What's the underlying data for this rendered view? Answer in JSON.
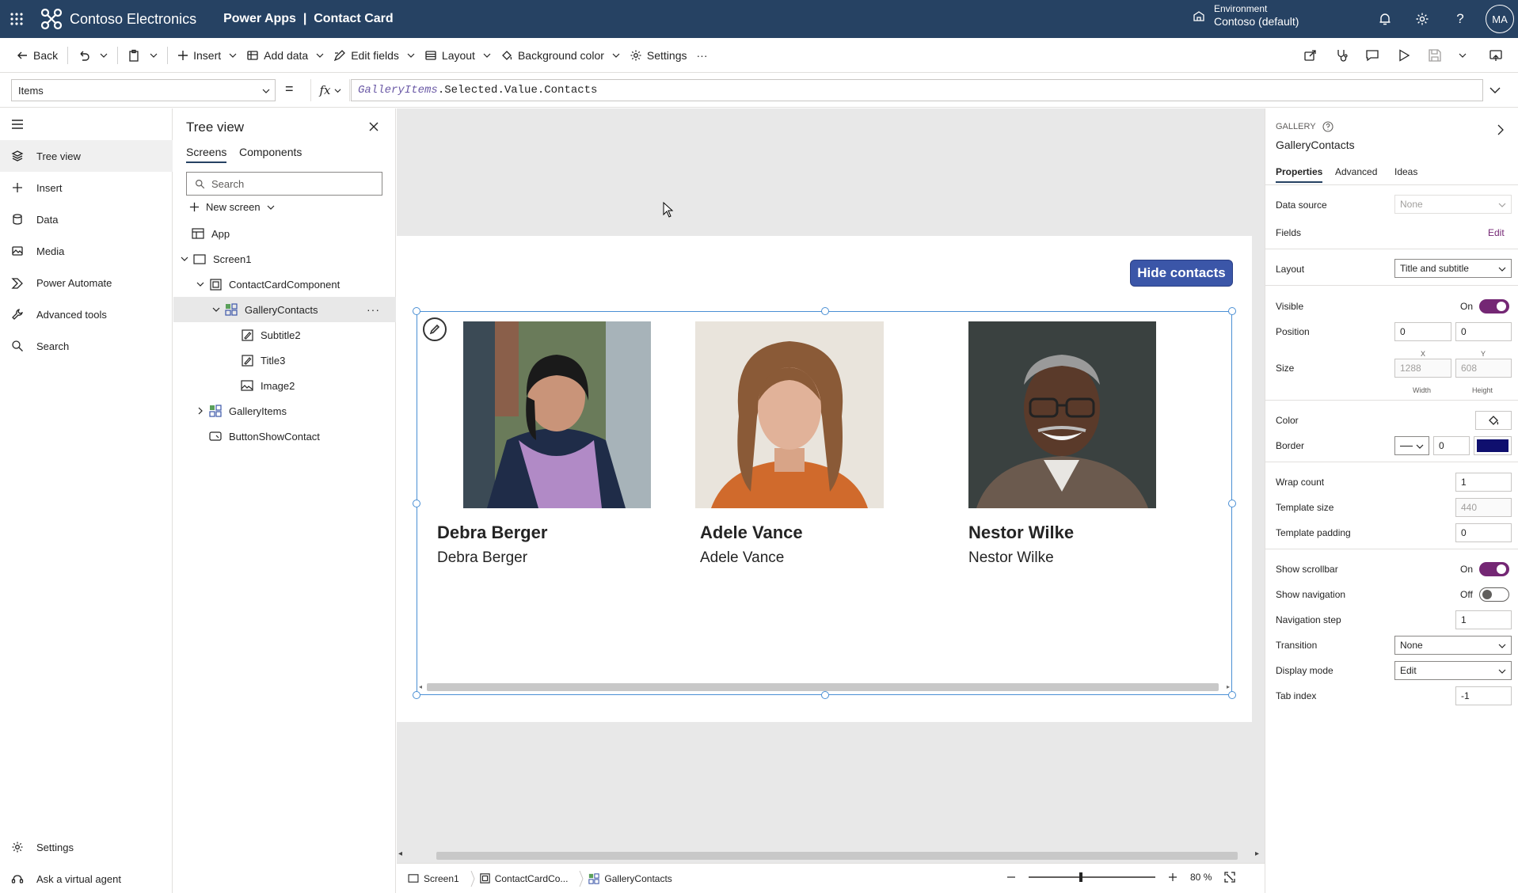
{
  "header": {
    "org_name": "Contoso Electronics",
    "app_title": "Power Apps  |  Contact Card",
    "environment_label": "Environment",
    "environment_value": "Contoso (default)",
    "avatar_initials": "MA"
  },
  "commandbar": {
    "back": "Back",
    "insert": "Insert",
    "add_data": "Add data",
    "edit_fields": "Edit fields",
    "layout": "Layout",
    "background_color": "Background color",
    "settings": "Settings",
    "more": "···"
  },
  "formulabar": {
    "property": "Items",
    "equals": "=",
    "fx": "fx",
    "formula_ident": "GalleryItems",
    "formula_rest": ".Selected.Value.Contacts"
  },
  "leftnav": {
    "items": [
      {
        "label": "Tree view",
        "icon": "layers-icon"
      },
      {
        "label": "Insert",
        "icon": "plus-icon"
      },
      {
        "label": "Data",
        "icon": "database-icon"
      },
      {
        "label": "Media",
        "icon": "media-icon"
      },
      {
        "label": "Power Automate",
        "icon": "flow-icon"
      },
      {
        "label": "Advanced tools",
        "icon": "wrench-icon"
      },
      {
        "label": "Search",
        "icon": "search-icon"
      }
    ],
    "settings": "Settings",
    "virtual_agent": "Ask a virtual agent"
  },
  "treeview": {
    "title": "Tree view",
    "tabs": [
      "Screens",
      "Components"
    ],
    "search_placeholder": "Search",
    "new_screen": "New screen",
    "nodes": [
      "App",
      "Screen1",
      "ContactCardComponent",
      "GalleryContacts",
      "Subtitle2",
      "Title3",
      "Image2",
      "GalleryItems",
      "ButtonShowContact"
    ]
  },
  "canvas": {
    "hide_button": "Hide contacts",
    "contacts": [
      {
        "title": "Debra Berger",
        "subtitle": "Debra Berger"
      },
      {
        "title": "Adele Vance",
        "subtitle": "Adele Vance"
      },
      {
        "title": "Nestor Wilke",
        "subtitle": "Nestor Wilke"
      }
    ]
  },
  "statusbar": {
    "crumbs": [
      "Screen1",
      "ContactCardCo...",
      "GalleryContacts"
    ],
    "zoom_value": "80",
    "zoom_unit": "%"
  },
  "properties": {
    "type": "GALLERY",
    "name": "GalleryContacts",
    "tabs": [
      "Properties",
      "Advanced",
      "Ideas"
    ],
    "data_source_label": "Data source",
    "data_source_value": "None",
    "fields_label": "Fields",
    "fields_edit": "Edit",
    "layout_label": "Layout",
    "layout_value": "Title and subtitle",
    "visible_label": "Visible",
    "visible_state": "On",
    "position_label": "Position",
    "position_x": "0",
    "position_y": "0",
    "x_label": "X",
    "y_label": "Y",
    "size_label": "Size",
    "size_width": "1288",
    "size_height": "608",
    "width_label": "Width",
    "height_label": "Height",
    "color_label": "Color",
    "border_label": "Border",
    "border_width": "0",
    "border_color": "#0f0f6e",
    "wrap_count_label": "Wrap count",
    "wrap_count": "1",
    "template_size_label": "Template size",
    "template_size": "440",
    "template_padding_label": "Template padding",
    "template_padding": "0",
    "show_scrollbar_label": "Show scrollbar",
    "show_scrollbar_state": "On",
    "show_navigation_label": "Show navigation",
    "show_navigation_state": "Off",
    "navigation_step_label": "Navigation step",
    "navigation_step": "1",
    "transition_label": "Transition",
    "transition_value": "None",
    "display_mode_label": "Display mode",
    "display_mode_value": "Edit",
    "tab_index_label": "Tab index",
    "tab_index": "-1"
  },
  "colors": {
    "header_bg": "#264263",
    "accent": "#742774",
    "button_bg": "#3b56a8",
    "selection": "#4a8fd4"
  }
}
